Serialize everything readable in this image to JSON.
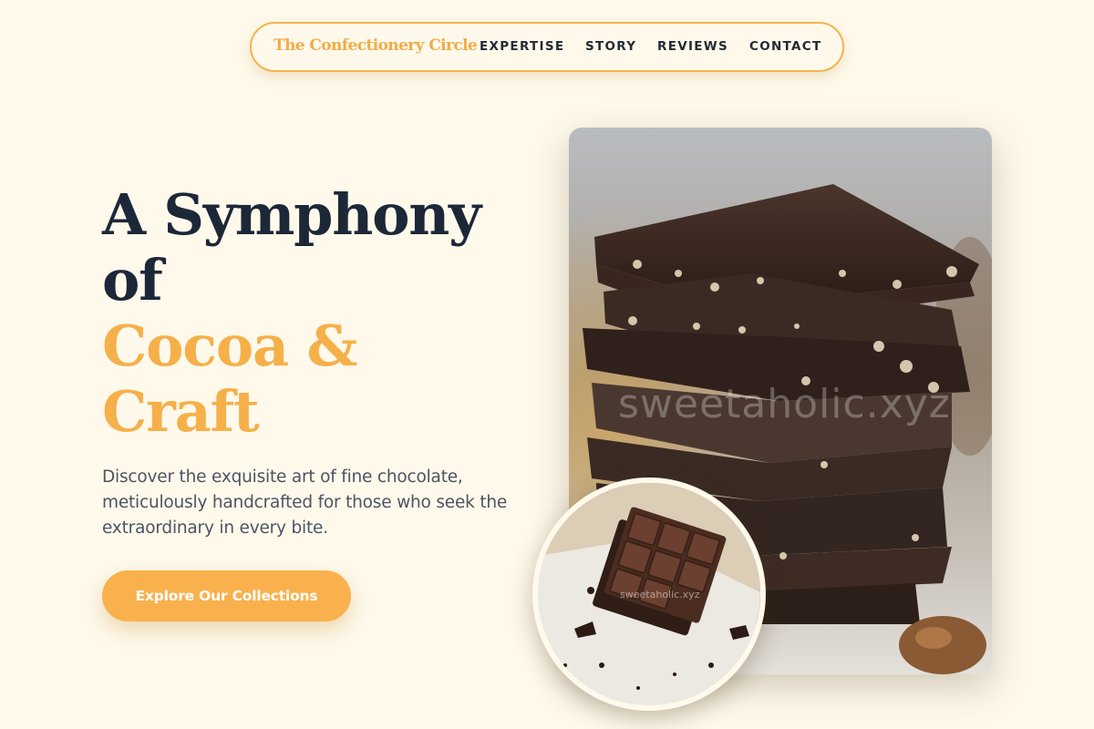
{
  "nav": {
    "brand": "The Confectionery Circle",
    "links": [
      "EXPERTISE",
      "STORY",
      "REVIEWS",
      "CONTACT"
    ]
  },
  "hero": {
    "headline_dark_1": "A Symphony",
    "headline_dark_2": "of",
    "headline_accent_1": "Cocoa &",
    "headline_accent_2": "Craft",
    "tagline": "Discover the exquisite art of fine chocolate, meticulously handcrafted for those who seek the extraordinary in every bite.",
    "cta_label": "Explore Our Collections"
  },
  "images": {
    "main_watermark": "sweetaholic.xyz",
    "circle_watermark": "sweetaholic.xyz"
  },
  "colors": {
    "background": "#fef9eb",
    "accent": "#f6b04a",
    "heading": "#1c2838",
    "body_text": "#4c5462"
  }
}
